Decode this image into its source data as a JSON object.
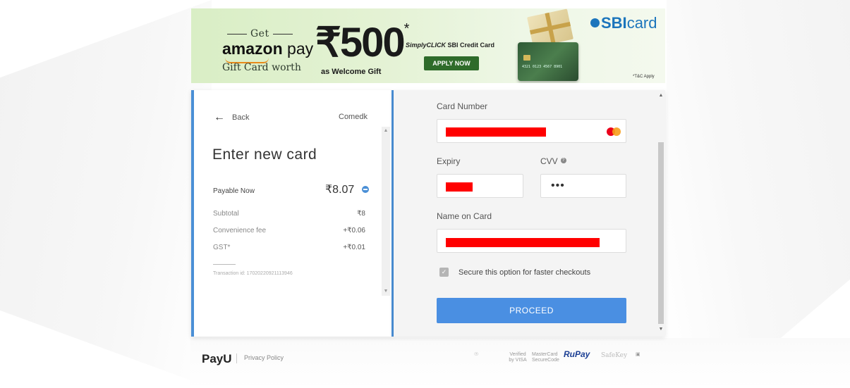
{
  "banner": {
    "get": "Get",
    "amazon_bold": "amazon",
    "amazon_pay": " pay",
    "gift_card_worth": "Gift Card worth",
    "amount": "₹500",
    "amount_sup": "*",
    "welcome_gift": "as Welcome Gift",
    "simply_prefix": "SimplyCLICK",
    "simply_suffix": " SBI Credit Card",
    "apply_now": "APPLY NOW",
    "brand_bold": "SBI",
    "brand_light": "card",
    "tnc": "*T&C Apply"
  },
  "left": {
    "back_label": "Back",
    "merchant": "Comedk",
    "title": "Enter new card",
    "payable_label": "Payable Now",
    "payable_amount": "₹8.07",
    "items": [
      {
        "label": "Subtotal",
        "value": "₹8"
      },
      {
        "label": "Convenience fee",
        "value": "+₹0.06"
      },
      {
        "label": "GST*",
        "value": "+₹0.01"
      }
    ],
    "transaction": "Transaction id: 17020220921113946"
  },
  "form": {
    "card_number_label": "Card Number",
    "expiry_label": "Expiry",
    "cvv_label": "CVV",
    "cvv_value": "•••",
    "name_label": "Name on Card",
    "secure_label": "Secure this option for faster checkouts",
    "proceed_label": "PROCEED"
  },
  "footer": {
    "brand": "PayU",
    "privacy": "Privacy Policy",
    "badges": [
      "Verified by VISA",
      "MasterCard SecureCode",
      "RuPay",
      "SafeKey"
    ]
  },
  "colors": {
    "accent": "#4a8fd6",
    "proceed": "#4a8fe2",
    "redaction": "#ff0000"
  }
}
